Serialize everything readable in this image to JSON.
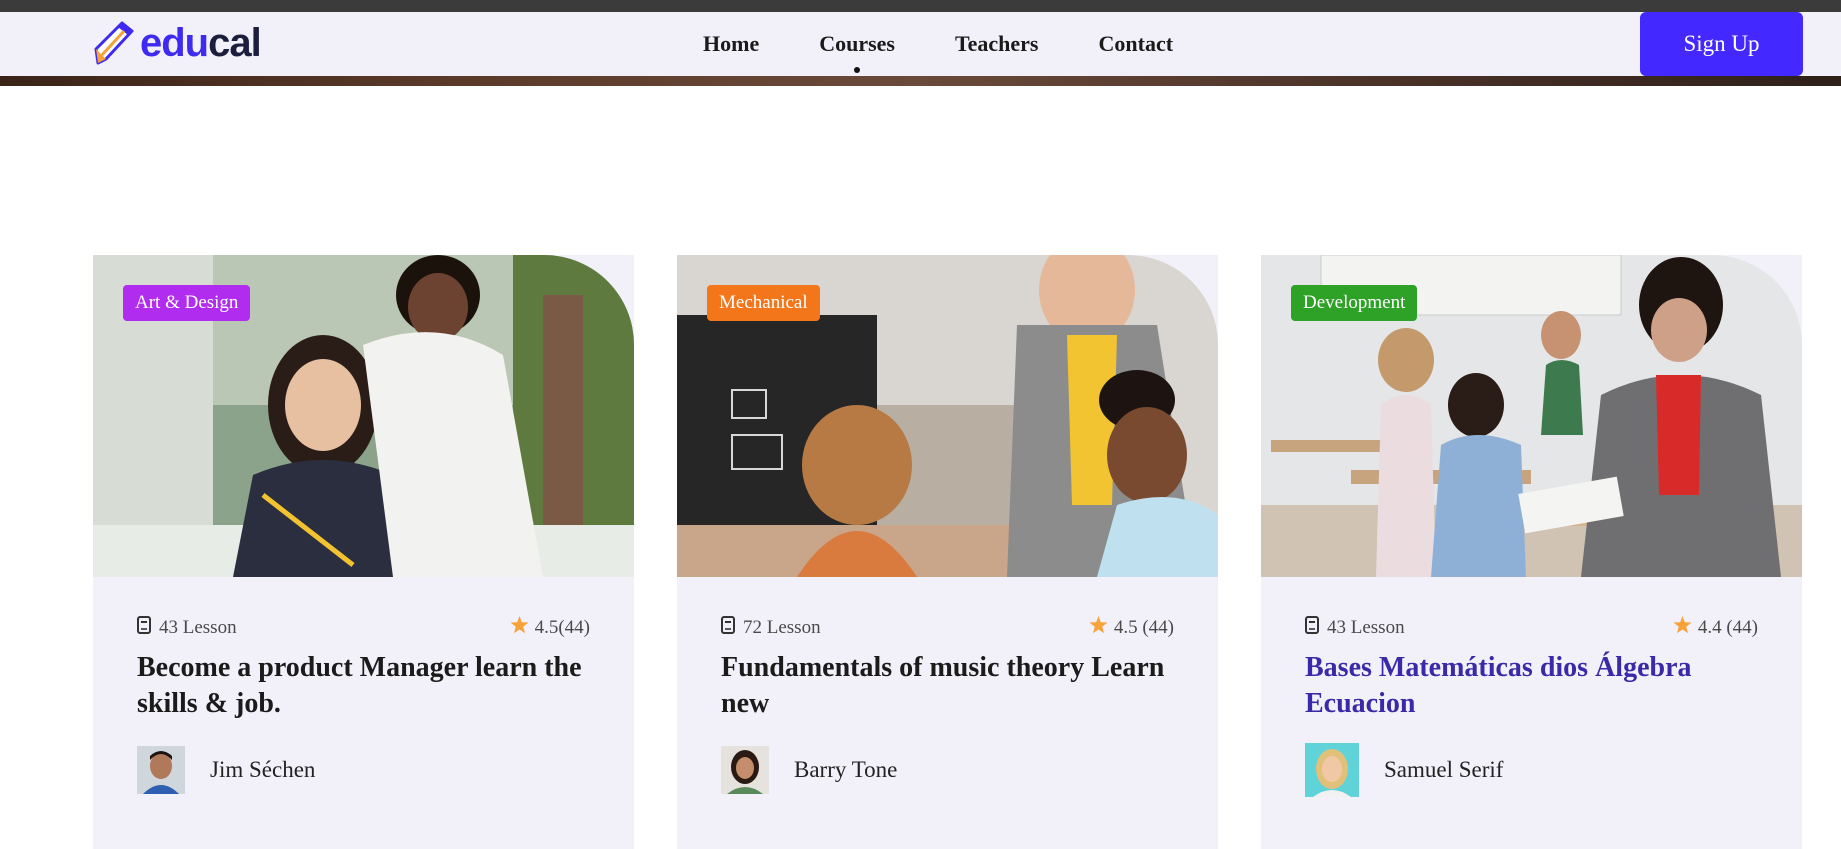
{
  "brand": {
    "part1": "edu",
    "part2": "cal"
  },
  "nav": {
    "items": [
      {
        "label": "Home"
      },
      {
        "label": "Courses",
        "active": true
      },
      {
        "label": "Teachers"
      },
      {
        "label": "Contact"
      }
    ],
    "signup_label": "Sign Up"
  },
  "colors": {
    "accent": "#4328ff",
    "card_bg": "#f2f1f9",
    "title_hover": "#3a29a8",
    "star": "#f8a23a"
  },
  "cards": [
    {
      "tag": "Art & Design",
      "tag_color": "#b02df0",
      "lessons": "43 Lesson",
      "rating": "4.5(44)",
      "title": "Become a product Manager learn the skills & job.",
      "author": "Jim Séchen",
      "image": "students-writing-photo"
    },
    {
      "tag": "Mechanical",
      "tag_color": "#f4761b",
      "lessons": "72 Lesson",
      "rating": "4.5 (44)",
      "title": "Fundamentals of music theory Learn new",
      "author": "Barry Tone",
      "image": "teacher-classroom-photo"
    },
    {
      "tag": "Development",
      "tag_color": "#2ea127",
      "lessons": "43 Lesson",
      "rating": "4.4 (44)",
      "title": "Bases Matemáticas dios Álgebra Ecuacion",
      "author": "Samuel Serif",
      "image": "kids-classroom-photo"
    }
  ]
}
